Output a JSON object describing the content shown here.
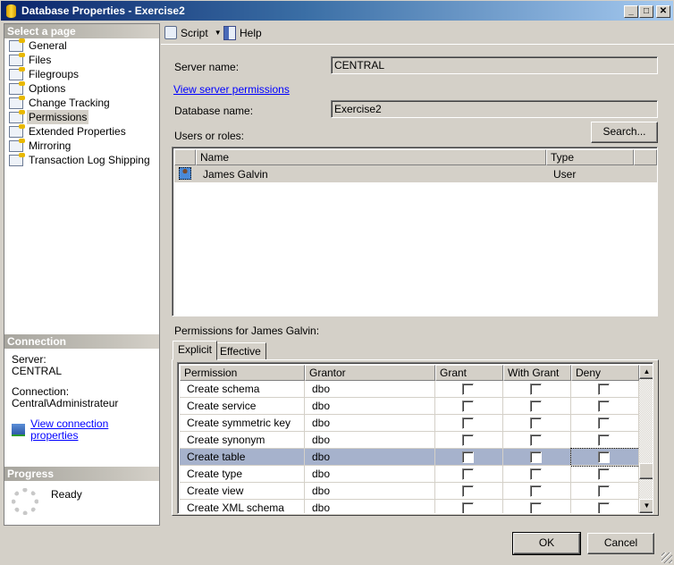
{
  "window": {
    "title": "Database Properties - Exercise2",
    "min": "_",
    "max": "□",
    "close": "✕"
  },
  "sidebar": {
    "header": "Select a page",
    "items": [
      {
        "label": "General"
      },
      {
        "label": "Files"
      },
      {
        "label": "Filegroups"
      },
      {
        "label": "Options"
      },
      {
        "label": "Change Tracking"
      },
      {
        "label": "Permissions",
        "selected": true
      },
      {
        "label": "Extended Properties"
      },
      {
        "label": "Mirroring"
      },
      {
        "label": "Transaction Log Shipping"
      }
    ],
    "connection": {
      "header": "Connection",
      "server_label": "Server:",
      "server": "CENTRAL",
      "connection_label": "Connection:",
      "connection": "Central\\Administrateur",
      "link": "View connection properties"
    },
    "progress": {
      "header": "Progress",
      "status": "Ready"
    }
  },
  "toolbar": {
    "script": "Script",
    "help": "Help"
  },
  "main": {
    "server_name_label": "Server name:",
    "server_name": "CENTRAL",
    "view_server_permissions": "View server permissions",
    "database_name_label": "Database name:",
    "database_name": "Exercise2",
    "users_label": "Users or roles:",
    "search_button": "Search...",
    "users_columns": [
      "Name",
      "Type"
    ],
    "users": [
      {
        "name": "James Galvin",
        "type": "User"
      }
    ],
    "permissions_label": "Permissions for James Galvin:",
    "tabs": [
      "Explicit",
      "Effective"
    ],
    "perm_columns": [
      "Permission",
      "Grantor",
      "Grant",
      "With Grant",
      "Deny"
    ],
    "permissions": [
      {
        "permission": "Create schema",
        "grantor": "dbo",
        "grant": false,
        "with_grant": false,
        "deny": false
      },
      {
        "permission": "Create service",
        "grantor": "dbo",
        "grant": false,
        "with_grant": false,
        "deny": false
      },
      {
        "permission": "Create symmetric key",
        "grantor": "dbo",
        "grant": false,
        "with_grant": false,
        "deny": false
      },
      {
        "permission": "Create synonym",
        "grantor": "dbo",
        "grant": false,
        "with_grant": false,
        "deny": false
      },
      {
        "permission": "Create table",
        "grantor": "dbo",
        "grant": false,
        "with_grant": false,
        "deny": false,
        "selected": true
      },
      {
        "permission": "Create type",
        "grantor": "dbo",
        "grant": false,
        "with_grant": false,
        "deny": false
      },
      {
        "permission": "Create view",
        "grantor": "dbo",
        "grant": false,
        "with_grant": false,
        "deny": false
      },
      {
        "permission": "Create XML schema coll...",
        "grantor": "dbo",
        "grant": false,
        "with_grant": false,
        "deny": false
      }
    ]
  },
  "footer": {
    "ok": "OK",
    "cancel": "Cancel"
  }
}
